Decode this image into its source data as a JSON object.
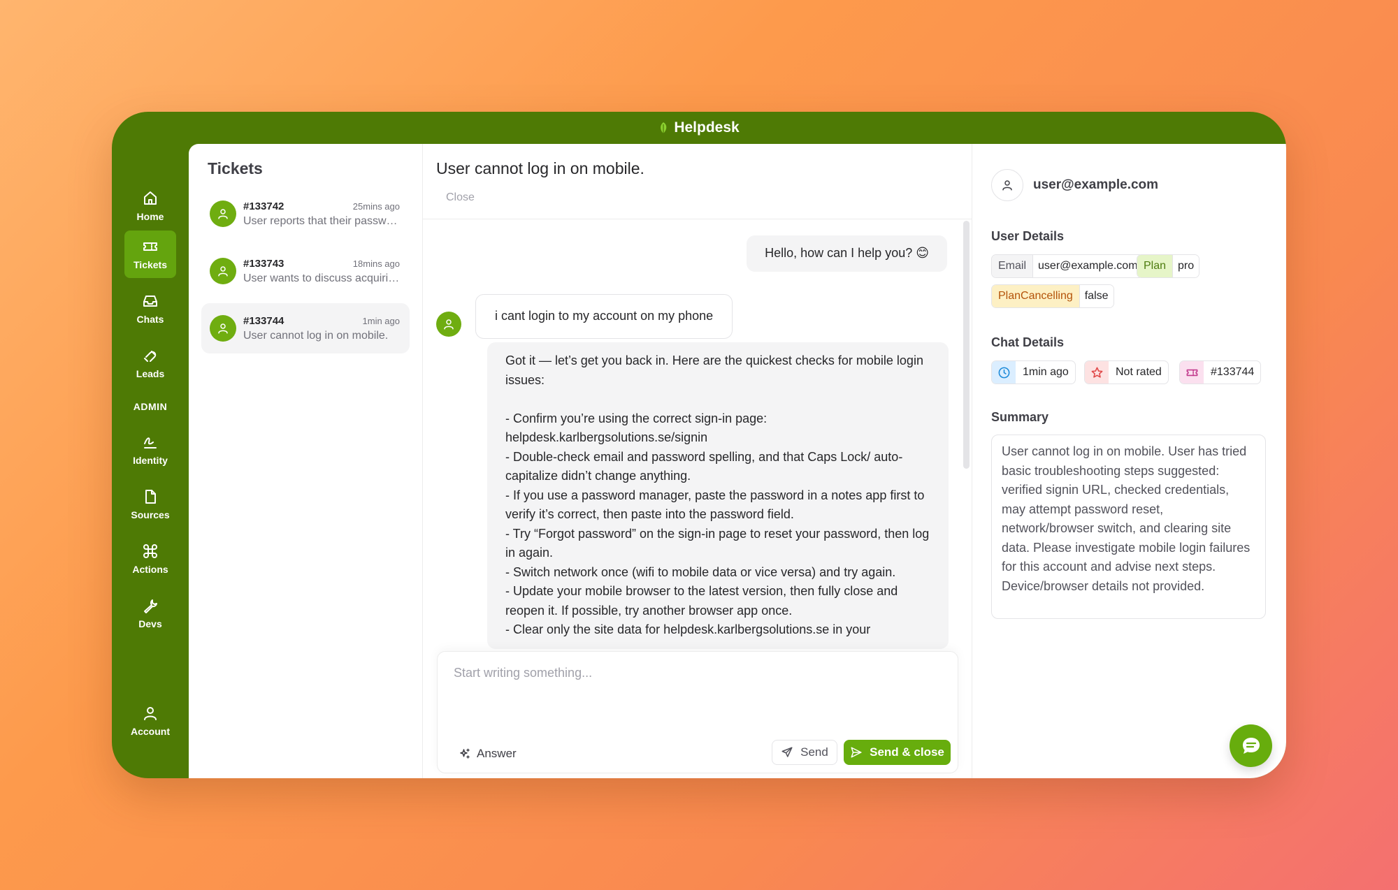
{
  "app": {
    "title": "Helpdesk"
  },
  "nav": {
    "items": [
      {
        "label": "Home",
        "icon": "home-icon"
      },
      {
        "label": "Tickets",
        "icon": "ticket-icon",
        "active": true
      },
      {
        "label": "Chats",
        "icon": "inbox-icon"
      },
      {
        "label": "Leads",
        "icon": "magnet-icon"
      }
    ],
    "admin_label": "ADMIN",
    "admin_items": [
      {
        "label": "Identity",
        "icon": "signature-icon"
      },
      {
        "label": "Sources",
        "icon": "file-icon"
      },
      {
        "label": "Actions",
        "icon": "command-icon"
      },
      {
        "label": "Devs",
        "icon": "wrench-icon"
      }
    ],
    "account_label": "Account"
  },
  "tickets": {
    "title": "Tickets",
    "items": [
      {
        "id": "#133742",
        "time": "25mins ago",
        "preview": "User reports that their password reset link has expired."
      },
      {
        "id": "#133743",
        "time": "18mins ago",
        "preview": "User wants to discuss acquiring a business license."
      },
      {
        "id": "#133744",
        "time": "1min ago",
        "preview": "User cannot log in on mobile.",
        "active": true
      }
    ]
  },
  "chat": {
    "title": "User cannot log in on mobile.",
    "close_label": "Close",
    "messages": [
      {
        "role": "agent",
        "text": "Hello, how can I help you? 😊"
      },
      {
        "role": "user",
        "text": "i cant login to my account on my phone"
      },
      {
        "role": "agent",
        "text": "Got it — let’s get you back in. Here are the quickest checks for mobile login issues:\n\n- Confirm you’re using the correct sign-in page: helpdesk.karlbergsolutions.se/signin\n- Double-check email and password spelling, and that Caps Lock/ auto-capitalize didn’t change anything.\n- If you use a password manager, paste the password in a notes app first to verify it’s correct, then paste into the password field.\n- Try “Forgot password” on the sign-in page to reset your password, then log in again.\n- Switch network once (wifi to mobile data or vice versa) and try again.\n- Update your mobile browser to the latest version, then fully close and reopen it. If possible, try another browser app once.\n- Clear only the site data for helpdesk.karlbergsolutions.se in your"
      }
    ],
    "composer": {
      "placeholder": "Start writing something...",
      "answer_label": "Answer",
      "send_label": "Send",
      "send_close_label": "Send & close"
    }
  },
  "details": {
    "user_email": "user@example.com",
    "user_details_title": "User Details",
    "fields": [
      {
        "key": "Email",
        "value": "user@example.com"
      },
      {
        "key": "Plan",
        "value": "pro"
      },
      {
        "key": "PlanCancelling",
        "value": "false"
      }
    ],
    "chat_details_title": "Chat Details",
    "chat_meta": [
      {
        "icon": "clock-icon",
        "label": "1min ago"
      },
      {
        "icon": "star-icon",
        "label": "Not rated"
      },
      {
        "icon": "ticket-icon",
        "label": "#133744"
      }
    ],
    "summary_title": "Summary",
    "summary": "User cannot log in on mobile. User has tried basic troubleshooting steps suggested: verified signin URL, checked credentials, may attempt password reset, network/browser switch, and clearing site data. Please investigate mobile login failures for this account and advise next steps. Device/browser details not provided."
  },
  "colors": {
    "brand": "#4e7a05",
    "accent": "#67ad0d"
  }
}
